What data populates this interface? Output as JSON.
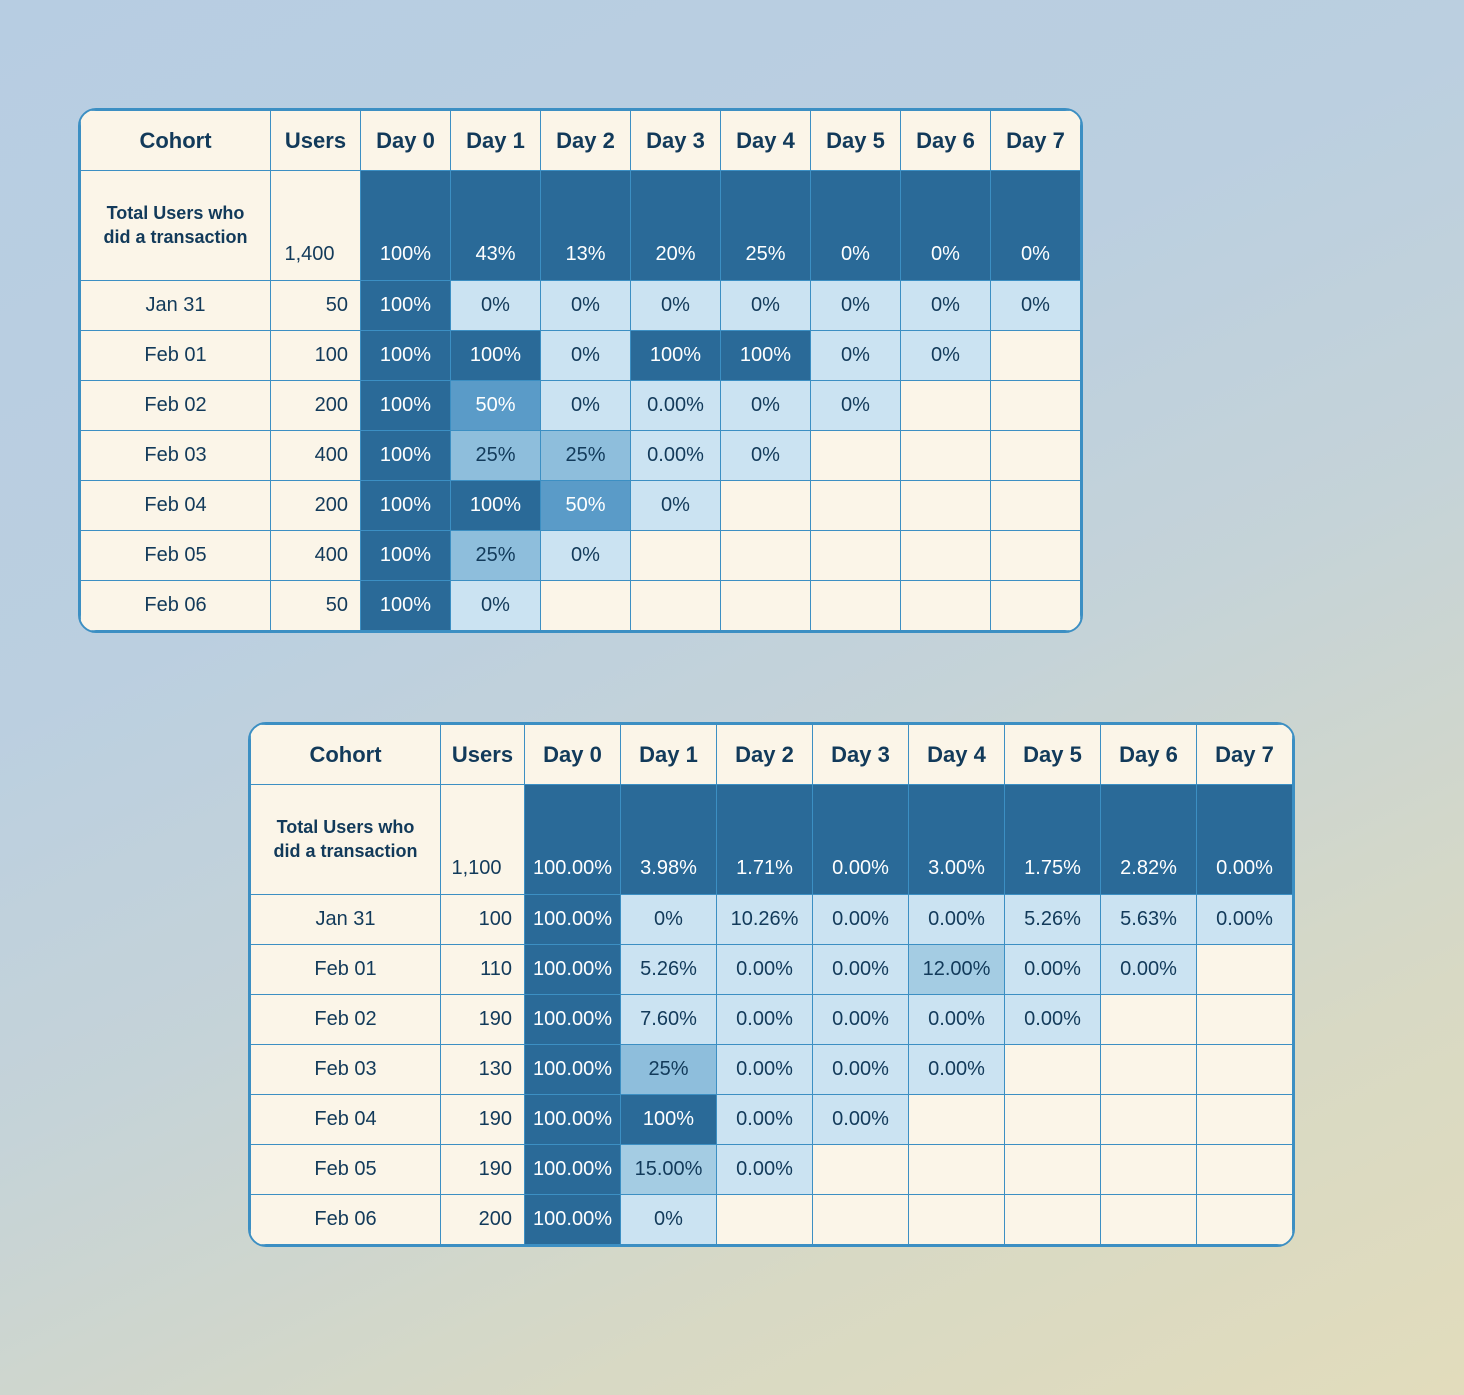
{
  "chart_data": [
    {
      "type": "table",
      "title": "Cohort retention (table 1)",
      "headers": [
        "Cohort",
        "Users",
        "Day 0",
        "Day 1",
        "Day 2",
        "Day 3",
        "Day 4",
        "Day 5",
        "Day 6",
        "Day 7"
      ],
      "total_row": {
        "label": "Total Users who did a transaction",
        "users": "1,400",
        "values": [
          "100%",
          "43%",
          "13%",
          "20%",
          "25%",
          "0%",
          "0%",
          "0%"
        ]
      },
      "rows": [
        {
          "cohort": "Jan 31",
          "users": "50",
          "values": [
            "100%",
            "0%",
            "0%",
            "0%",
            "0%",
            "0%",
            "0%",
            "0%"
          ]
        },
        {
          "cohort": "Feb 01",
          "users": "100",
          "values": [
            "100%",
            "100%",
            "0%",
            "100%",
            "100%",
            "0%",
            "0%",
            null
          ]
        },
        {
          "cohort": "Feb 02",
          "users": "200",
          "values": [
            "100%",
            "50%",
            "0%",
            "0.00%",
            "0%",
            "0%",
            null,
            null
          ]
        },
        {
          "cohort": "Feb 03",
          "users": "400",
          "values": [
            "100%",
            "25%",
            "25%",
            "0.00%",
            "0%",
            null,
            null,
            null
          ]
        },
        {
          "cohort": "Feb 04",
          "users": "200",
          "values": [
            "100%",
            "100%",
            "50%",
            "0%",
            null,
            null,
            null,
            null
          ]
        },
        {
          "cohort": "Feb 05",
          "users": "400",
          "values": [
            "100%",
            "25%",
            "0%",
            null,
            null,
            null,
            null,
            null
          ]
        },
        {
          "cohort": "Feb 06",
          "users": "50",
          "values": [
            "100%",
            "0%",
            null,
            null,
            null,
            null,
            null,
            null
          ]
        }
      ]
    },
    {
      "type": "table",
      "title": "Cohort retention (table 2)",
      "headers": [
        "Cohort",
        "Users",
        "Day 0",
        "Day 1",
        "Day 2",
        "Day 3",
        "Day 4",
        "Day 5",
        "Day 6",
        "Day 7"
      ],
      "total_row": {
        "label": "Total Users who did a transaction",
        "users": "1,100",
        "values": [
          "100.00%",
          "3.98%",
          "1.71%",
          "0.00%",
          "3.00%",
          "1.75%",
          "2.82%",
          "0.00%"
        ]
      },
      "rows": [
        {
          "cohort": "Jan 31",
          "users": "100",
          "values": [
            "100.00%",
            "0%",
            "10.26%",
            "0.00%",
            "0.00%",
            "5.26%",
            "5.63%",
            "0.00%"
          ]
        },
        {
          "cohort": "Feb 01",
          "users": "110",
          "values": [
            "100.00%",
            "5.26%",
            "0.00%",
            "0.00%",
            "12.00%",
            "0.00%",
            "0.00%",
            null
          ]
        },
        {
          "cohort": "Feb 02",
          "users": "190",
          "values": [
            "100.00%",
            "7.60%",
            "0.00%",
            "0.00%",
            "0.00%",
            "0.00%",
            null,
            null
          ]
        },
        {
          "cohort": "Feb 03",
          "users": "130",
          "values": [
            "100.00%",
            "25%",
            "0.00%",
            "0.00%",
            "0.00%",
            null,
            null,
            null
          ]
        },
        {
          "cohort": "Feb 04",
          "users": "190",
          "values": [
            "100.00%",
            "100%",
            "0.00%",
            "0.00%",
            null,
            null,
            null,
            null
          ]
        },
        {
          "cohort": "Feb 05",
          "users": "190",
          "values": [
            "100.00%",
            "15.00%",
            "0.00%",
            null,
            null,
            null,
            null,
            null
          ]
        },
        {
          "cohort": "Feb 06",
          "users": "200",
          "values": [
            "100.00%",
            "0%",
            null,
            null,
            null,
            null,
            null,
            null
          ]
        }
      ]
    }
  ]
}
